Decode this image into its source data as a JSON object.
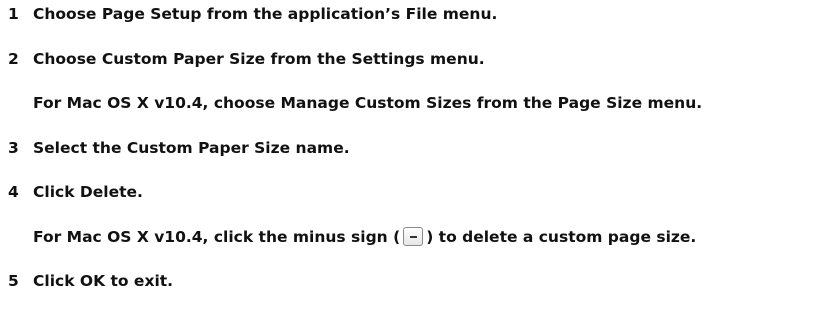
{
  "steps": [
    {
      "number": "1",
      "text": "Choose Page Setup from the application’s File menu."
    },
    {
      "number": "2",
      "text": "Choose Custom Paper Size from the Settings menu."
    },
    {
      "note": "For Mac OS X v10.4, choose Manage Custom Sizes from the Page Size menu."
    },
    {
      "number": "3",
      "text": "Select the Custom Paper Size name."
    },
    {
      "number": "4",
      "text": "Click Delete."
    },
    {
      "note_before": "For Mac OS X v10.4, click the minus sign (",
      "note_after": ") to delete a custom page size.",
      "icon": "minus-button-icon"
    },
    {
      "number": "5",
      "text": "Click OK to exit."
    }
  ]
}
